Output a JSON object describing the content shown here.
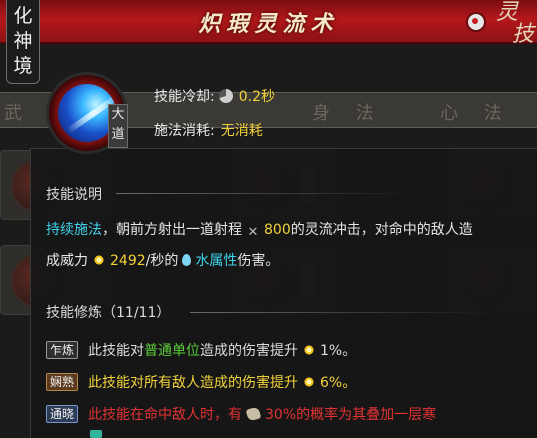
{
  "header": {
    "title": "炽瑕灵流术",
    "corner_label": [
      "灵",
      "技"
    ]
  },
  "realm_tag": [
    "化",
    "神",
    "境"
  ],
  "background": {
    "tabs": [
      "武 技",
      "身 法",
      "心 法"
    ]
  },
  "skill": {
    "badge": [
      "大",
      "道"
    ],
    "cooldown_label": "技能冷却:",
    "cooldown_value": "0.2秒",
    "cost_label": "施法消耗:",
    "cost_value": "无消耗"
  },
  "description": {
    "title": "技能说明",
    "segments_line1": {
      "s1": "持续施法",
      "s2": "，朝前方射出一道射程",
      "s3": "800",
      "s4": "的灵流冲击，对命中的敌人造"
    },
    "segments_line2": {
      "s1": "成威力",
      "s2": "2492",
      "s3": "/秒的",
      "s4": "水属性",
      "s5": "伤害。"
    }
  },
  "training": {
    "title": "技能修炼（11/11）",
    "items": [
      {
        "badge": "乍炼",
        "p1": "此技能对",
        "p2": "普通单位",
        "p3": "造成的伤害提升",
        "p4": "1%。"
      },
      {
        "badge": "娴熟",
        "p1": "此技能对所有敌人造成的伤害提升",
        "p2": "6%。"
      },
      {
        "badge": "通晓",
        "p1": "此技能在命中敌人时，有",
        "p2": "30%的概率为其叠加一层寒"
      }
    ]
  },
  "colors": {
    "header_red": "#b4181b",
    "highlight_cyan": "#3fd0e8",
    "highlight_yellow": "#f1d23a",
    "highlight_green": "#5ccc3a",
    "highlight_red": "#e23333"
  },
  "icons": {
    "cooldown": "clock-pie-icon",
    "range": "crossed-arrows-icon",
    "power": "sun-burst-icon",
    "element": "water-drop-icon",
    "chance": "stone-icon"
  }
}
